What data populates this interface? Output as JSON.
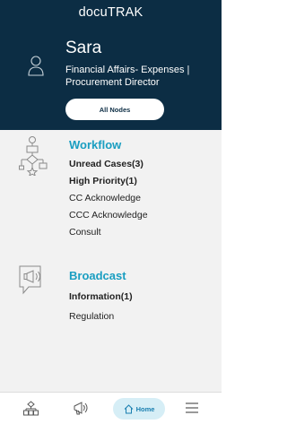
{
  "app": {
    "title": "docuTRAK"
  },
  "user": {
    "name": "Sara",
    "role": "Financial Affairs- Expenses | Procurement Director",
    "all_nodes_label": "All Nodes"
  },
  "workflow": {
    "title": "Workflow",
    "items": [
      {
        "label": "Unread Cases(3)",
        "bold": true
      },
      {
        "label": "High Priority(1)",
        "bold": true
      },
      {
        "label": "CC Acknowledge",
        "bold": false
      },
      {
        "label": "CCC Acknowledge",
        "bold": false
      },
      {
        "label": "Consult",
        "bold": false
      }
    ]
  },
  "broadcast": {
    "title": "Broadcast",
    "items": [
      {
        "label": "Information(1)",
        "bold": true
      },
      {
        "label": "Regulation",
        "bold": false
      }
    ]
  },
  "bottom_nav": {
    "home_label": "Home",
    "icons": [
      "workflow-icon",
      "broadcast-icon",
      "home-icon",
      "menu-icon"
    ]
  },
  "colors": {
    "header_bg": "#0c2d44",
    "accent": "#1a9ec1",
    "content_bg": "#f2f2f2",
    "home_pill_bg": "#d6eef6"
  }
}
